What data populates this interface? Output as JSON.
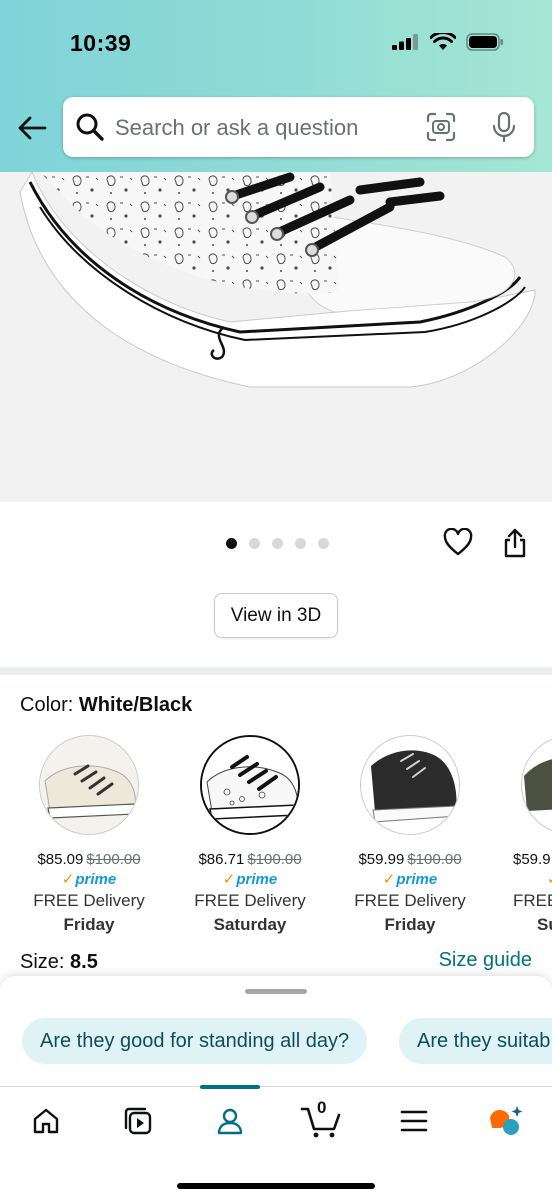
{
  "status_bar": {
    "time": "10:39"
  },
  "search": {
    "placeholder": "Search or ask a question"
  },
  "gallery": {
    "dot_count": 5,
    "active_index": 0,
    "view_3d_label": "View in 3D"
  },
  "color": {
    "label": "Color:",
    "selected": "White/Black"
  },
  "swatches": [
    {
      "price": "$85.09",
      "list_price": "$100.00",
      "prime": "prime",
      "delivery": "FREE Delivery",
      "day": "Friday"
    },
    {
      "price": "$86.71",
      "list_price": "$100.00",
      "prime": "prime",
      "delivery": "FREE Delivery",
      "day": "Saturday",
      "selected": true
    },
    {
      "price": "$59.99",
      "list_price": "$100.00",
      "prime": "prime",
      "delivery": "FREE Delivery",
      "day": "Friday"
    },
    {
      "price": "$59.9",
      "list_price": "",
      "prime": "",
      "delivery": "FREE",
      "day": "Su"
    }
  ],
  "size": {
    "label": "Size:",
    "selected": "8.5",
    "guide_label": "Size guide"
  },
  "questions": [
    {
      "label": "Are they good for standing all day?"
    },
    {
      "label": "Are they suitab"
    }
  ],
  "tabbar": {
    "cart_count": "0",
    "active_tab": "profile",
    "tabs": [
      "home-icon",
      "video-icon",
      "profile-icon",
      "cart-icon",
      "menu-icon",
      "rufus-icon"
    ]
  },
  "colors": {
    "accent": "#007185",
    "prime_blue": "#1399d4",
    "prime_check": "#f79400",
    "header_start": "#7fd3d8",
    "header_end": "#a6e6d4",
    "chip_bg": "#dff3f7"
  }
}
